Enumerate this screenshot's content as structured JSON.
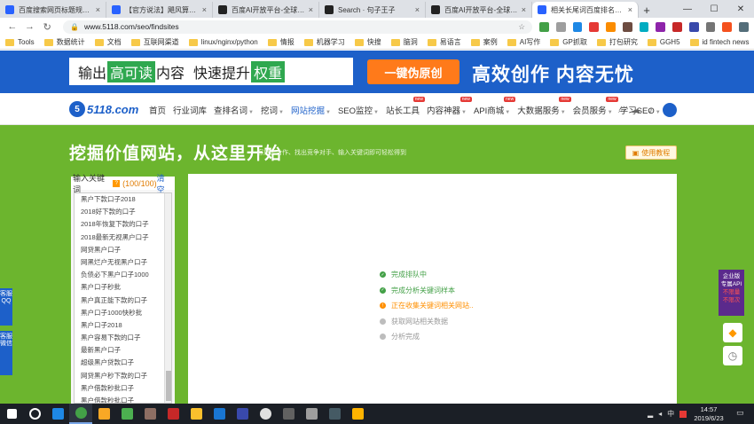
{
  "browser": {
    "tabs": [
      {
        "label": "百度搜索网页标题规范_百度",
        "icon_color": "#2962ff",
        "active": false
      },
      {
        "label": "【官方说法】飓风算法2.0",
        "icon_color": "#2962ff",
        "active": false
      },
      {
        "label": "百度AI开放平台-全球领先",
        "icon_color": "#222222",
        "active": false
      },
      {
        "label": "Search · 句子王子",
        "icon_color": "#222222",
        "active": false
      },
      {
        "label": "百度AI开放平台-全球领先",
        "icon_color": "#222222",
        "active": false
      },
      {
        "label": "相关长尾词百度排名最好的",
        "icon_color": "#2962ff",
        "active": true
      }
    ],
    "new_tab": "+",
    "window_controls": {
      "minimize": "—",
      "maximize": "☐",
      "close": "✕"
    },
    "url": "www.5118.com/seo/findsites",
    "bookmarks": [
      "Tools",
      "数据统计",
      "文档",
      "互联网渠道",
      "linux/nginx/python",
      "情报",
      "机器学习",
      "快搜",
      "脑洞",
      "易语言",
      "案例",
      "AI写作",
      "GP抓取",
      "打包研究",
      "GGH5",
      "id fintech news"
    ]
  },
  "banner": {
    "lead": "输出",
    "hl1": "高可读",
    "mid1": "内容",
    "mid2": "快速提升",
    "hl2": "权重",
    "cta": "一键伪原创",
    "slogan": "高效创作  内容无忧"
  },
  "sitenav": {
    "logo": "5118.com",
    "logo_mark": "5",
    "links": [
      {
        "label": "首页",
        "caret": false,
        "badge": ""
      },
      {
        "label": "行业词库",
        "caret": false,
        "badge": ""
      },
      {
        "label": "查排名词",
        "caret": true,
        "badge": ""
      },
      {
        "label": "挖词",
        "caret": true,
        "badge": ""
      },
      {
        "label": "网站挖掘",
        "caret": true,
        "badge": "",
        "active": true
      },
      {
        "label": "SEO监控",
        "caret": true,
        "badge": ""
      },
      {
        "label": "站长工具",
        "caret": false,
        "badge": "new"
      },
      {
        "label": "内容神器",
        "caret": true,
        "badge": "new"
      },
      {
        "label": "API商城",
        "caret": true,
        "badge": "new"
      },
      {
        "label": "大数据服务",
        "caret": true,
        "badge": "new"
      },
      {
        "label": "会员服务",
        "caret": true,
        "badge": "new"
      },
      {
        "label": "学习SEO",
        "caret": true,
        "badge": ""
      }
    ]
  },
  "hero": {
    "title": "挖掘价值网站，从这里开始",
    "subtitle": "客户、合作、找出竞争对手、输入关键词即可轻松得到",
    "tutorial": "使用教程"
  },
  "keywords": {
    "header_label": "输入关键词",
    "count": "(100/100)",
    "clear": "清空",
    "items": [
      "黑户下款口子2018",
      "2018好下款的口子",
      "2018年恢复下款的口子",
      "2018最新无视黑户口子",
      "网贷黑户口子",
      "网黑烂户无视黑户口子",
      "负债必下黑户口子1000",
      "黑户口子秒批",
      "黑户真正能下款的口子",
      "黑户口子1000快秒批",
      "黑户口子2018",
      "黑户容易下款的口子",
      "最新黑户口子",
      "超级黑户贷款口子",
      "网贷黑户秒下款的口子",
      "黑户借款秒批口子",
      "黑户借款秒批口子"
    ]
  },
  "progress": {
    "steps": [
      {
        "label": "完成排队中",
        "status": "done"
      },
      {
        "label": "完成分析关键词样本",
        "status": "done"
      },
      {
        "label": "正在收集关键词相关网站..",
        "status": "running"
      },
      {
        "label": "获取网站相关数据",
        "status": "pending"
      },
      {
        "label": "分析完成",
        "status": "pending"
      }
    ]
  },
  "floats": {
    "service_qq": "客服QQ",
    "service_wechat": "客服微信",
    "enterprise_line1": "企业版",
    "enterprise_line2": "专属API",
    "enterprise_line3": "不限量",
    "enterprise_line4": "不限次"
  },
  "taskbar": {
    "tray_lang": "中",
    "time": "14:57",
    "date": "2019/6/23"
  },
  "colors": {
    "brand_blue": "#1d60c9",
    "hero_green": "#6cb52e",
    "cta_orange": "#ff7a1a",
    "done_green": "#43a047",
    "running_orange": "#ff8f00"
  }
}
